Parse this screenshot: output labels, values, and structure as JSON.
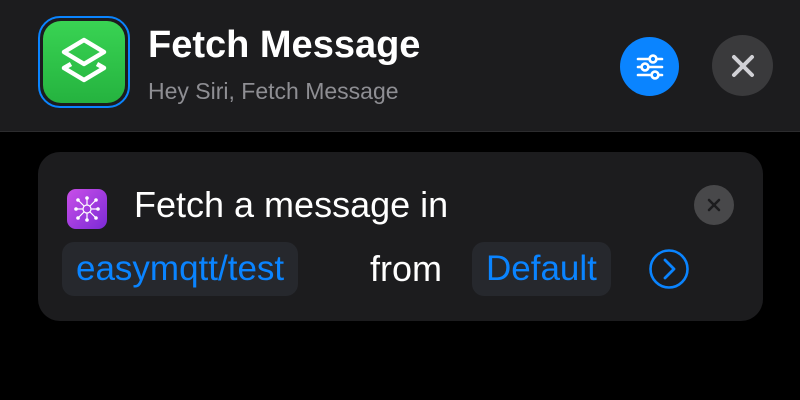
{
  "header": {
    "title": "Fetch Message",
    "subtitle": "Hey Siri, Fetch Message",
    "app_icon": "shortcuts-icon",
    "settings_icon": "sliders-icon",
    "close_icon": "close-icon"
  },
  "action": {
    "icon": "network-nodes-icon",
    "text": "Fetch a message in",
    "topic": "easymqtt/test",
    "connector": "from",
    "broker": "Default",
    "remove_icon": "close-icon",
    "expand_icon": "chevron-right-circle-icon"
  },
  "colors": {
    "background": "#000000",
    "header_bg": "#1c1c1e",
    "card_bg": "#1c1c1e",
    "accent": "#0a84ff",
    "app_icon_green": "#30c94a",
    "action_icon_purple": "#a93ee0",
    "text_primary": "#ffffff",
    "text_secondary": "#8e8e93"
  }
}
